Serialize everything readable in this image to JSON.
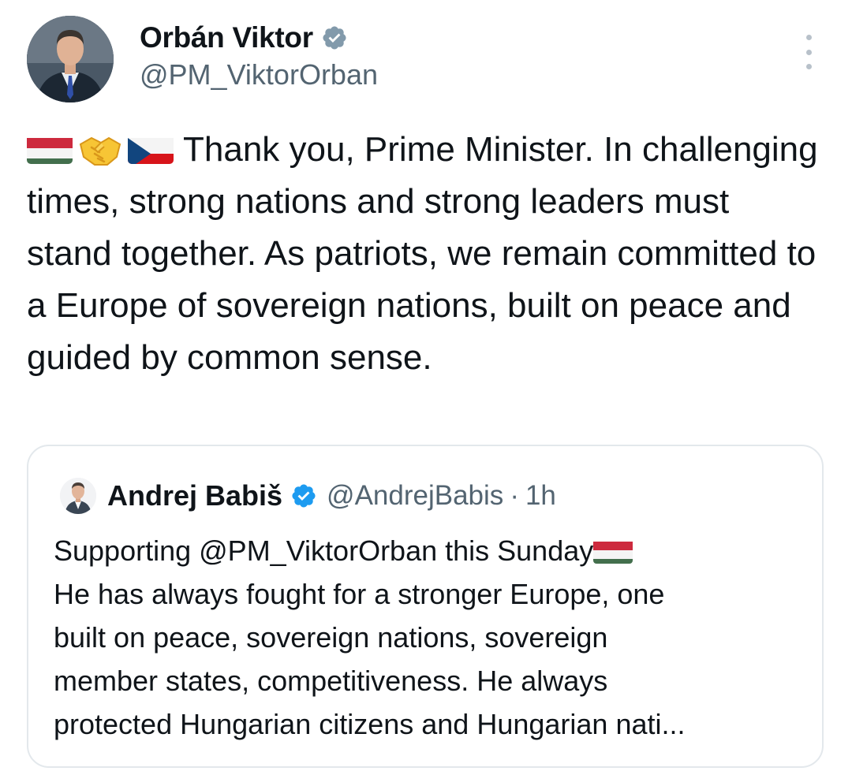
{
  "author": {
    "name": "Orbán Viktor",
    "handle": "@PM_ViktorOrban",
    "verified_icon": "verified-badge-icon"
  },
  "tweet": {
    "emojis": [
      "hungary-flag",
      "handshake",
      "czech-flag"
    ],
    "text": "Thank you, Prime Minister. In challenging times, strong nations and strong leaders must stand together. As patriots, we remain committed to a Europe of sovereign nations, built on peace and guided by common sense."
  },
  "quote": {
    "name": "Andrej Babiš",
    "handle": "@AndrejBabis",
    "separator": "·",
    "time": "1h",
    "lines": [
      "Supporting @PM_ViktorOrban this Sunday",
      "He has always fought for a stronger Europe, one",
      "built on peace, sovereign nations, sovereign",
      "member states, competitiveness. He always",
      "protected Hungarian citizens and Hungarian nati..."
    ],
    "trailing_emoji": "hungary-flag"
  },
  "colors": {
    "text": "#0f1419",
    "secondary": "#536471",
    "verified": "#829aab",
    "verified_blue": "#1d9bf0",
    "border": "#e3e8ec"
  }
}
